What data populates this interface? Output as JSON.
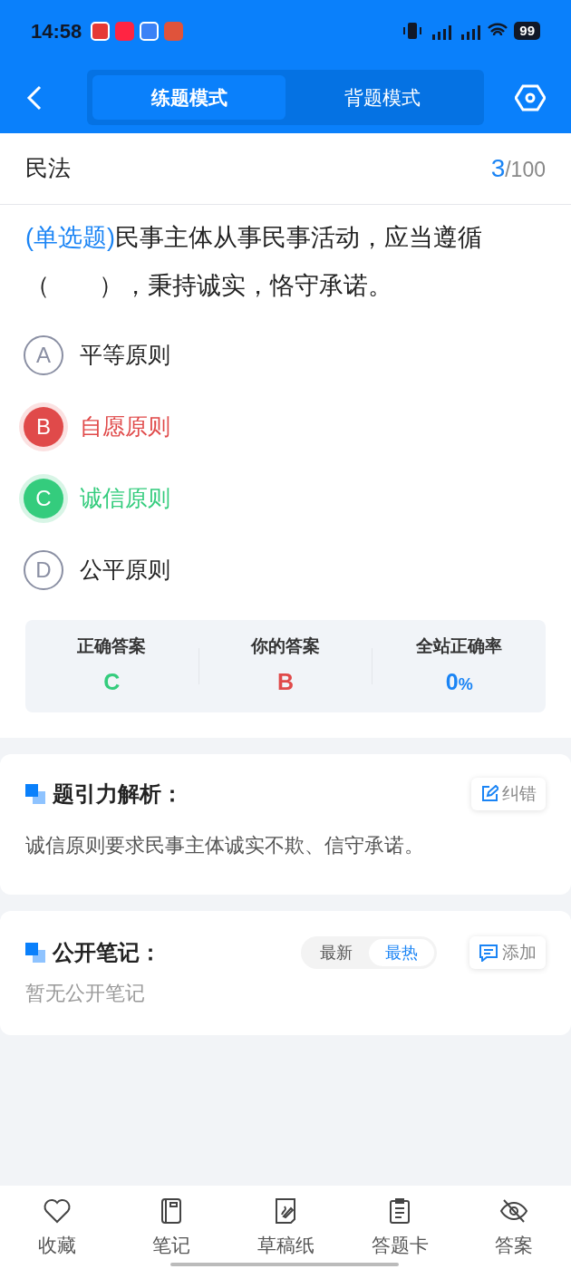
{
  "status_bar": {
    "time": "14:58",
    "battery": "99"
  },
  "tabs": [
    {
      "label": "练题模式",
      "selected": true
    },
    {
      "label": "背题模式",
      "selected": false
    }
  ],
  "subject": {
    "title": "民法",
    "current": "3",
    "total": "/100"
  },
  "question": {
    "type_label": "(单选题)",
    "text": "民事主体从事民事活动，应当遵循（　　），秉持诚实，恪守承诺。"
  },
  "options": [
    {
      "letter": "A",
      "text": "平等原则",
      "kind": "neutral"
    },
    {
      "letter": "B",
      "text": "自愿原则",
      "kind": "wrong"
    },
    {
      "letter": "C",
      "text": "诚信原则",
      "kind": "correct"
    },
    {
      "letter": "D",
      "text": "公平原则",
      "kind": "neutral"
    }
  ],
  "answer_panel": [
    {
      "label": "正确答案",
      "value": "C",
      "kind": "correct"
    },
    {
      "label": "你的答案",
      "value": "B",
      "kind": "wrong"
    },
    {
      "label": "全站正确率",
      "value": "0",
      "unit": "%",
      "kind": "rate"
    }
  ],
  "analysis": {
    "title": "题引力解析：",
    "action": "纠错",
    "text": "诚信原则要求民事主体诚实不欺、信守承诺。"
  },
  "notes": {
    "title": "公开笔记：",
    "sort": [
      {
        "label": "最新",
        "selected": false
      },
      {
        "label": "最热",
        "selected": true
      }
    ],
    "action": "添加",
    "empty": "暂无公开笔记"
  },
  "bottom_bar": [
    {
      "label": "收藏",
      "kind": "heart"
    },
    {
      "label": "笔记",
      "kind": "notebook"
    },
    {
      "label": "草稿纸",
      "kind": "draft"
    },
    {
      "label": "答题卡",
      "kind": "card"
    },
    {
      "label": "答案",
      "kind": "eye"
    }
  ]
}
